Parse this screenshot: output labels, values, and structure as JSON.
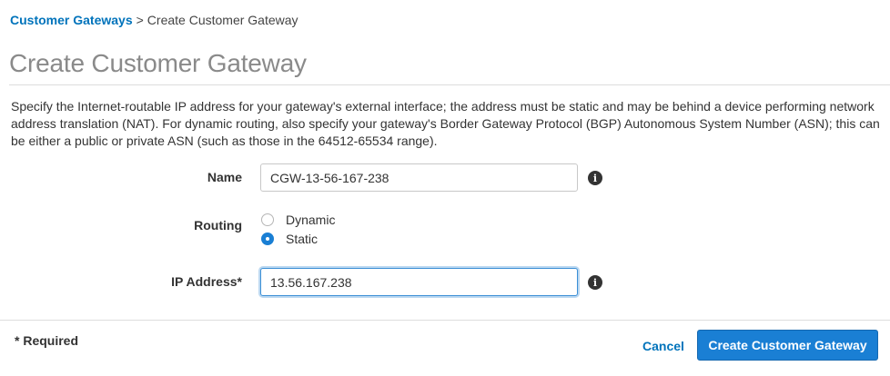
{
  "breadcrumb": {
    "parent": "Customer Gateways",
    "separator": ">",
    "current": "Create Customer Gateway"
  },
  "page_title": "Create Customer Gateway",
  "description": "Specify the Internet-routable IP address for your gateway's external interface; the address must be static and may be behind a device performing network address translation (NAT). For dynamic routing, also specify your gateway's Border Gateway Protocol (BGP) Autonomous System Number (ASN); this can be either a public or private ASN (such as those in the 64512-65534 range).",
  "form": {
    "name": {
      "label": "Name",
      "value": "CGW-13-56-167-238",
      "info_icon": "i"
    },
    "routing": {
      "label": "Routing",
      "options": [
        {
          "label": "Dynamic",
          "selected": false
        },
        {
          "label": "Static",
          "selected": true
        }
      ]
    },
    "ip_address": {
      "label": "IP Address*",
      "value": "13.56.167.238",
      "info_icon": "i"
    }
  },
  "footer": {
    "required_note": "* Required",
    "cancel_label": "Cancel",
    "submit_label": "Create Customer Gateway"
  },
  "colors": {
    "link": "#0073bb",
    "primary": "#1a7fd4",
    "title": "#8a8a8a",
    "focus": "#3b8fd6"
  },
  "icons": {
    "info": "info-circle-icon",
    "radio_checked": "radio-checked",
    "radio_unchecked": "radio-unchecked"
  }
}
